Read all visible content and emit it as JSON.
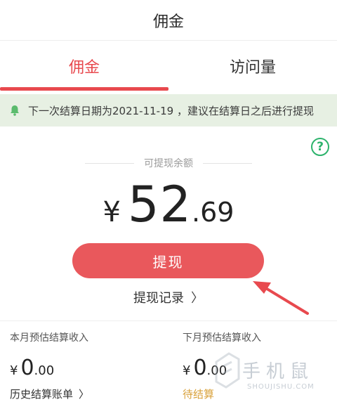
{
  "nav": {
    "title": "佣金"
  },
  "tabs": [
    {
      "label": "佣金",
      "active": true
    },
    {
      "label": "访问量",
      "active": false
    }
  ],
  "notice": {
    "text": "下一次结算日期为2021-11-19 ，建议在结算日之后进行提现"
  },
  "help": {
    "glyph": "?"
  },
  "balance": {
    "label": "可提现余额",
    "currency": "¥",
    "integer": "52",
    "decimal": ".69"
  },
  "withdraw": {
    "label": "提现"
  },
  "record": {
    "label": "提现记录",
    "chevron": "〉"
  },
  "this_month": {
    "title": "本月预估结算收入",
    "currency": "¥",
    "integer": "0",
    "decimal": ".00",
    "link": "历史结算账单",
    "chevron": "〉"
  },
  "next_month": {
    "title": "下月预估结算收入",
    "currency": "¥",
    "integer": "0",
    "decimal": ".00",
    "status": "待结算"
  },
  "watermark": {
    "text": "手机鼠",
    "sub": "SHOUJISHU.COM"
  },
  "colors": {
    "accent": "#e8494e",
    "button": "#e9585c",
    "notice_bg": "#e7f0e3",
    "help": "#2db36c",
    "pending": "#d9a23c"
  }
}
